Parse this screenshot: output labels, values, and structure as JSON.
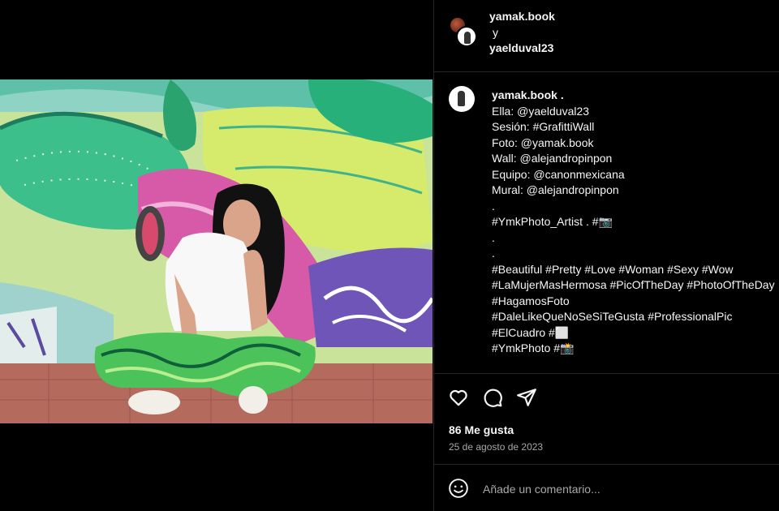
{
  "header": {
    "user1": "yamak.book",
    "connector": "y",
    "user2": "yaelduval23"
  },
  "caption": {
    "username": "yamak.book",
    "username_suffix": " .",
    "lines": [
      "Ella: @yaelduval23",
      "Sesión: #GrafittiWall",
      "Foto: @yamak.book",
      "Wall: @alejandropinpon",
      "Equipo: @canonmexicana",
      "Mural: @alejandropinpon",
      ".",
      "#YmkPhoto_Artist . #📷",
      ".",
      ".",
      "#Beautiful #Pretty #Love #Woman #Sexy #Wow",
      "#LaMujerMasHermosa #PicOfTheDay #PhotoOfTheDay",
      "#HagamosFoto",
      "#DaleLikeQueNoSeSiTeGusta #ProfessionalPic",
      "#ElCuadro #⬜",
      "#YmkPhoto #📸"
    ],
    "cutoff_line": "#...................................................."
  },
  "actions": {
    "icons": [
      "heart-icon",
      "comment-icon",
      "share-icon"
    ],
    "likes": "86 Me gusta",
    "date": "25 de agosto de 2023"
  },
  "comment": {
    "placeholder": "Añade un comentario..."
  }
}
